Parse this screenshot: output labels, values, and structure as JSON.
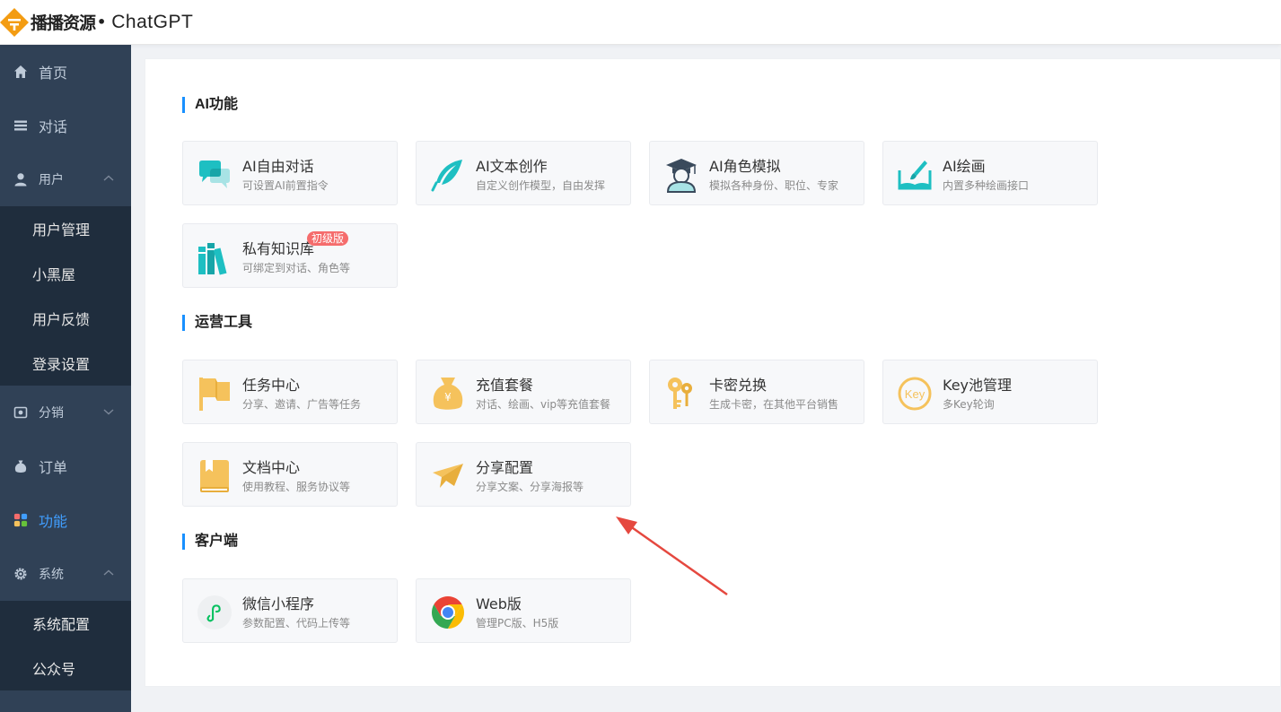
{
  "header": {
    "brand": "播播资源",
    "dot": "•",
    "app_name": "ChatGPT"
  },
  "sidebar": {
    "items": [
      {
        "label": "首页",
        "icon": "home-icon"
      },
      {
        "label": "对话",
        "icon": "list-icon"
      },
      {
        "label": "用户",
        "icon": "user-icon",
        "expanded": true
      },
      {
        "label": "分销",
        "icon": "distribution-icon",
        "expanded": false
      },
      {
        "label": "订单",
        "icon": "money-bag-icon"
      },
      {
        "label": "功能",
        "icon": "apps-icon",
        "active": true
      },
      {
        "label": "系统",
        "icon": "gear-icon",
        "expanded": true
      }
    ],
    "user_sub": [
      "用户管理",
      "小黑屋",
      "用户反馈",
      "登录设置"
    ],
    "system_sub": [
      "系统配置",
      "公众号"
    ]
  },
  "sections": {
    "ai": {
      "title": "AI功能",
      "cards": [
        {
          "title": "AI自由对话",
          "desc": "可设置AI前置指令",
          "icon": "chat-bubbles-icon"
        },
        {
          "title": "AI文本创作",
          "desc": "自定义创作模型，自由发挥",
          "icon": "feather-icon"
        },
        {
          "title": "AI角色模拟",
          "desc": "模拟各种身份、职位、专家",
          "icon": "graduate-icon"
        },
        {
          "title": "AI绘画",
          "desc": "内置多种绘画接口",
          "icon": "paint-brush-icon"
        },
        {
          "title": "私有知识库",
          "desc": "可绑定到对话、角色等",
          "icon": "books-icon",
          "badge": "初级版"
        }
      ]
    },
    "ops": {
      "title": "运营工具",
      "cards": [
        {
          "title": "任务中心",
          "desc": "分享、邀请、广告等任务",
          "icon": "flag-icon"
        },
        {
          "title": "充值套餐",
          "desc": "对话、绘画、vip等充值套餐",
          "icon": "money-bag-icon"
        },
        {
          "title": "卡密兑换",
          "desc": "生成卡密，在其他平台销售",
          "icon": "keys-icon"
        },
        {
          "title": "Key池管理",
          "desc": "多Key轮询",
          "icon": "key-badge-icon",
          "icon_text": "Key"
        },
        {
          "title": "文档中心",
          "desc": "使用教程、服务协议等",
          "icon": "document-icon"
        },
        {
          "title": "分享配置",
          "desc": "分享文案、分享海报等",
          "icon": "paper-plane-icon"
        }
      ]
    },
    "client": {
      "title": "客户端",
      "cards": [
        {
          "title": "微信小程序",
          "desc": "参数配置、代码上传等",
          "icon": "mini-program-icon"
        },
        {
          "title": "Web版",
          "desc": "管理PC版、H5版",
          "icon": "chrome-icon"
        }
      ]
    }
  },
  "colors": {
    "sidebar_bg": "#304156",
    "submenu_bg": "#1f2d3d",
    "active": "#409eff",
    "teal_icon": "#1ebfc2",
    "yellow_icon": "#f5c25c",
    "badge": "#f56c6c",
    "annotation_arrow": "#e5483f"
  }
}
